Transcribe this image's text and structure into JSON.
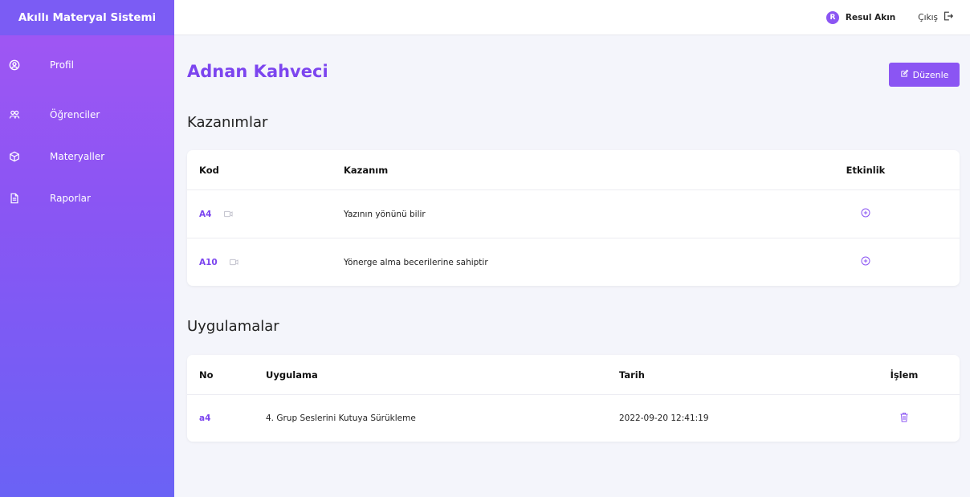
{
  "app": {
    "title": "Akıllı Materyal Sistemi"
  },
  "sidebar": {
    "items": [
      {
        "label": "Profil",
        "icon": "user-circle-icon"
      },
      {
        "label": "Öğrenciler",
        "icon": "users-icon"
      },
      {
        "label": "Materyaller",
        "icon": "cube-icon"
      },
      {
        "label": "Raporlar",
        "icon": "file-icon"
      }
    ]
  },
  "topbar": {
    "avatar_letter": "R",
    "user_name": "Resul Akın",
    "logout_label": "Çıkış"
  },
  "main": {
    "page_title": "Adnan Kahveci",
    "edit_label": "Düzenle"
  },
  "outcomes": {
    "title": "Kazanımlar",
    "columns": [
      "Kod",
      "Kazanım",
      "Etkinlik"
    ],
    "rows": [
      {
        "code": "A4",
        "text": "Yazının yönünü bilir"
      },
      {
        "code": "A10",
        "text": "Yönerge alma becerilerine sahiptir"
      }
    ]
  },
  "applications": {
    "title": "Uygulamalar",
    "columns": [
      "No",
      "Uygulama",
      "Tarih",
      "İşlem"
    ],
    "rows": [
      {
        "no": "a4",
        "name": "4. Grup Seslerini Kutuya Sürükleme",
        "date": "2022-09-20 12:41:19"
      }
    ]
  },
  "colors": {
    "accent": "#8b55f3",
    "title": "#7c45ef",
    "sidebar_top": "#a356f3",
    "sidebar_bottom": "#6a62f5"
  }
}
